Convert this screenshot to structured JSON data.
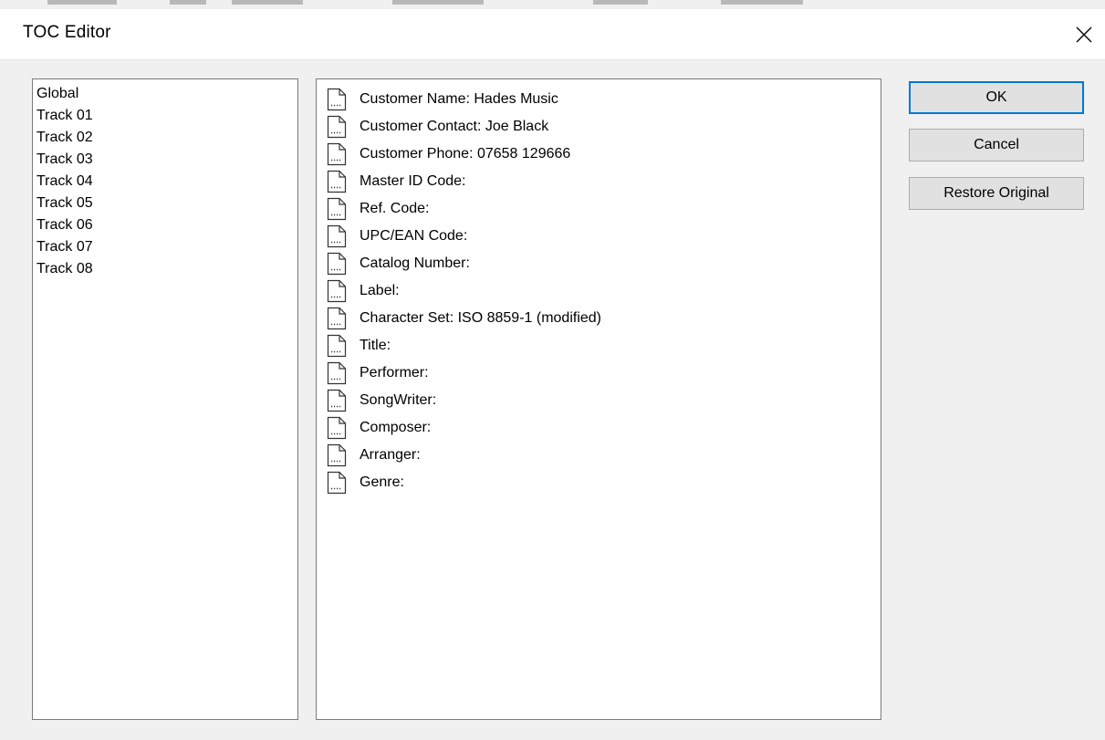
{
  "dialog": {
    "title": "TOC Editor",
    "close_icon": "close-icon"
  },
  "sections": [
    "Global",
    "Track 01",
    "Track 02",
    "Track 03",
    "Track 04",
    "Track 05",
    "Track 06",
    "Track 07",
    "Track 08"
  ],
  "fields": [
    "Customer Name: Hades Music",
    "Customer Contact: Joe Black",
    "Customer Phone: 07658 129666",
    "Master ID Code:",
    "Ref. Code:",
    "UPC/EAN Code:",
    "Catalog Number:",
    "Label:",
    "Character Set: ISO 8859-1 (modified)",
    "Title:",
    "Performer:",
    "SongWriter:",
    "Composer:",
    "Arranger:",
    "Genre:"
  ],
  "field_icon": "document-icon",
  "buttons": {
    "ok": "OK",
    "cancel": "Cancel",
    "restore": "Restore Original"
  },
  "colors": {
    "default_button_border": "#0078d7",
    "button_face": "#e1e1e1",
    "dialog_background": "#f0f0f0"
  }
}
